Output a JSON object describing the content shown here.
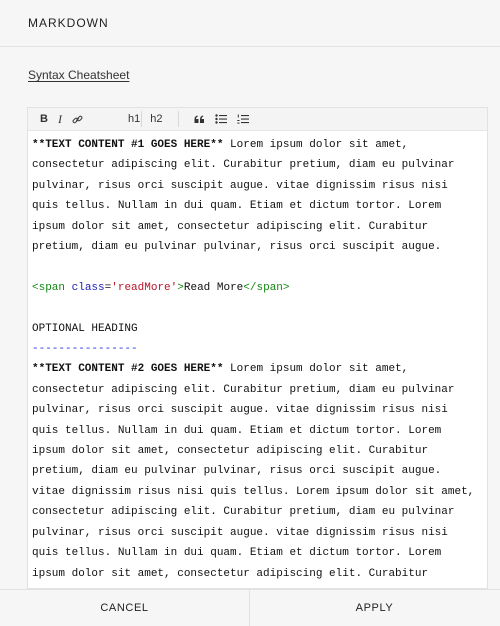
{
  "header": {
    "title": "MARKDOWN"
  },
  "links": {
    "cheatsheet": "Syntax Cheatsheet"
  },
  "toolbar": {
    "bold": "B",
    "italic": "I",
    "h1": "h1",
    "h2": "h2",
    "icons": [
      "bold-icon",
      "italic-icon",
      "link-icon",
      "h1-button",
      "h2-button",
      "quote-icon",
      "bulleted-list-icon",
      "numbered-list-icon"
    ]
  },
  "editor": {
    "para1_bold": "**TEXT CONTENT #1 GOES HERE**",
    "para1_text": " Lorem ipsum dolor sit amet, consectetur adipiscing elit. Curabitur pretium, diam eu pulvinar pulvinar, risus orci suscipit augue. vitae dignissim risus nisi quis tellus. Nullam in dui quam. Etiam et dictum tortor. Lorem ipsum dolor sit amet, consectetur adipiscing elit. Curabitur pretium, diam eu pulvinar pulvinar, risus orci suscipit augue.",
    "span_open": "<span",
    "span_attr": "class",
    "span_eq": "=",
    "span_val": "'readMore'",
    "span_close_bracket": ">",
    "span_text": "Read More",
    "span_close": "</span>",
    "heading": "OPTIONAL HEADING",
    "heading_rule": "----------------",
    "para2_bold": "**TEXT CONTENT #2 GOES HERE**",
    "para2_text": " Lorem ipsum dolor sit amet, consectetur adipiscing elit. Curabitur pretium, diam eu pulvinar pulvinar, risus orci suscipit augue. vitae dignissim risus nisi quis tellus. Nullam in dui quam. Etiam et dictum tortor. Lorem ipsum dolor sit amet, consectetur adipiscing elit. Curabitur pretium, diam eu pulvinar pulvinar, risus orci suscipit augue. vitae dignissim risus nisi quis tellus. Lorem ipsum dolor sit amet, consectetur adipiscing elit. Curabitur pretium, diam eu pulvinar pulvinar, risus orci suscipit augue. vitae dignissim risus nisi quis tellus. Nullam in dui quam. Etiam et dictum tortor. Lorem ipsum dolor sit amet, consectetur adipiscing elit. Curabitur pretium, diam eu pulvinar pulvinar, risus orci suscipit augue. vitae dignissim risus nisi quis tellus."
  },
  "footer": {
    "cancel": "CANCEL",
    "apply": "APPLY"
  },
  "colors": {
    "tag": "#118811",
    "attr": "#2222bb",
    "string": "#b5162a",
    "heading_rule": "#2233dd"
  }
}
